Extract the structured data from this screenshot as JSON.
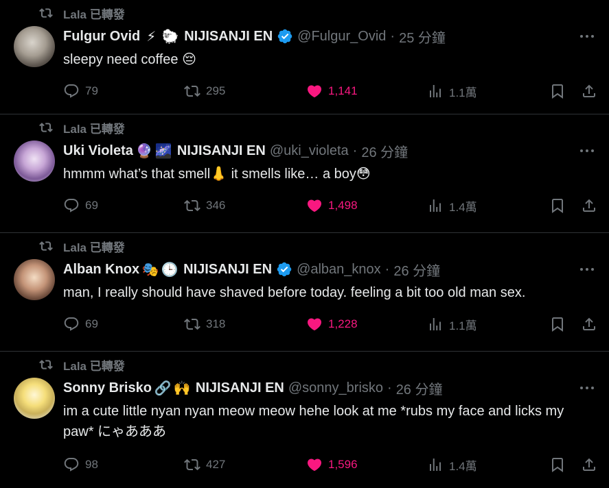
{
  "colors": {
    "background": "#000000",
    "text": "#e7e9ea",
    "muted": "#71767b",
    "like": "#f91880",
    "verified": "#1d9bf0",
    "divider": "#2f3336"
  },
  "tweets": [
    {
      "repost_label": "Lala 已轉發",
      "name": "Fulgur Ovid",
      "emojis": [
        "⚡",
        "🐑"
      ],
      "affiliation": "NIJISANJI EN",
      "verified": true,
      "handle": "@Fulgur_Ovid",
      "time": "25 分鐘",
      "text": "sleepy need coffee 😔",
      "replies": "79",
      "reposts": "295",
      "likes": "1,141",
      "views": "1.1萬"
    },
    {
      "repost_label": "Lala 已轉發",
      "name": "Uki Violeta",
      "emojis": [
        "🔮",
        "🌌"
      ],
      "affiliation": "NIJISANJI EN",
      "verified": false,
      "handle": "@uki_violeta",
      "time": "26 分鐘",
      "text": "hmmm what’s that smell👃 it smells like… a boy😳",
      "replies": "69",
      "reposts": "346",
      "likes": "1,498",
      "views": "1.4萬"
    },
    {
      "repost_label": "Lala 已轉發",
      "name": "Alban Knox",
      "emojis": [
        "🎭",
        "🕒"
      ],
      "affiliation": "NIJISANJI EN",
      "verified": true,
      "handle": "@alban_knox",
      "time": "26 分鐘",
      "text": "man, I really should have shaved before today. feeling a bit too old man sex.",
      "replies": "69",
      "reposts": "318",
      "likes": "1,228",
      "views": "1.1萬"
    },
    {
      "repost_label": "Lala 已轉發",
      "name": "Sonny Brisko",
      "emojis": [
        "🔗",
        "🙌"
      ],
      "affiliation": "NIJISANJI EN",
      "verified": false,
      "handle": "@sonny_brisko",
      "time": "26 分鐘",
      "text": "im a cute little nyan nyan meow meow hehe look at me *rubs my face and licks my paw*  にゃあああ",
      "replies": "98",
      "reposts": "427",
      "likes": "1,596",
      "views": "1.4萬"
    }
  ],
  "separator": "·"
}
